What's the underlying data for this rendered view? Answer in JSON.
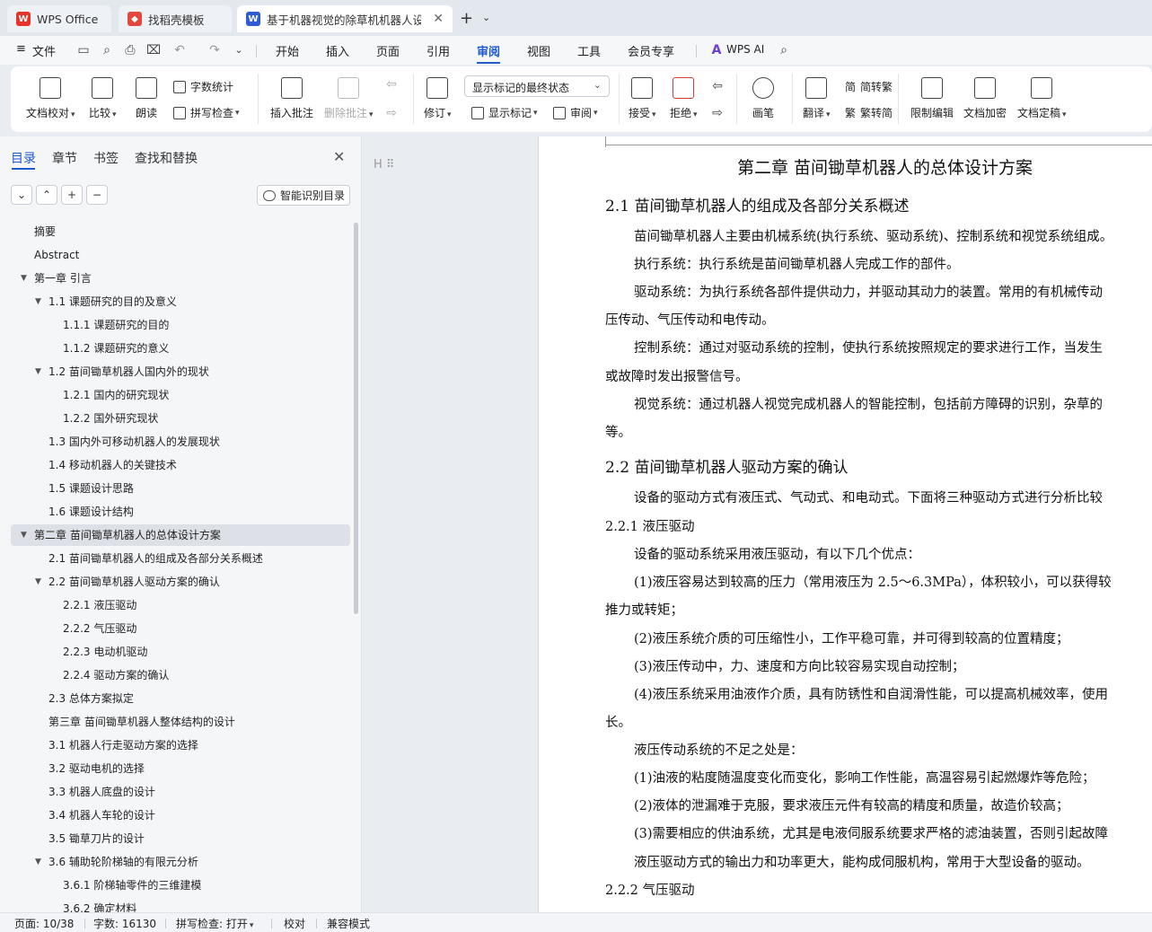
{
  "tabs": [
    {
      "label": "WPS Office",
      "active": false
    },
    {
      "label": "找稻壳模板",
      "active": false
    },
    {
      "label": "基于机器视觉的除草机机器人设",
      "active": true
    }
  ],
  "menubar": {
    "file": "文件",
    "items": [
      "开始",
      "插入",
      "页面",
      "引用",
      "审阅",
      "视图",
      "工具",
      "会员专享"
    ],
    "active": "审阅",
    "ai": "WPS AI"
  },
  "ribbon": {
    "doc_proof": "文档校对",
    "compare": "比较",
    "read_aloud": "朗读",
    "word_count": "字数统计",
    "spell_check": "拼写检查",
    "insert_comment": "插入批注",
    "delete_comment": "删除批注",
    "markup_state": "显示标记的最终状态",
    "track_changes": "修订",
    "show_markup": "显示标记",
    "review": "审阅",
    "accept": "接受",
    "reject": "拒绝",
    "pen": "画笔",
    "translate": "翻译",
    "to_traditional": "简转繁",
    "to_simplified": "繁转简",
    "restrict_edit": "限制编辑",
    "encrypt": "文档加密",
    "finalize": "文档定稿",
    "small_letter_trad": "繁",
    "small_letter_simp": "简"
  },
  "nav": {
    "tabs": [
      "目录",
      "章节",
      "书签",
      "查找和替换"
    ],
    "smart_toc": "智能识别目录",
    "items": [
      {
        "text": "摘要",
        "level": 1,
        "arrow": false
      },
      {
        "text": "Abstract",
        "level": 1,
        "arrow": false
      },
      {
        "text": "第一章  引言",
        "level": 1,
        "arrow": true
      },
      {
        "text": "1.1  课题研究的目的及意义",
        "level": 2,
        "arrow": true
      },
      {
        "text": "1.1.1 课题研究的目的",
        "level": 3,
        "arrow": false
      },
      {
        "text": "1.1.2  课题研究的意义",
        "level": 3,
        "arrow": false
      },
      {
        "text": "1.2 苗间锄草机器人国内外的现状",
        "level": 2,
        "arrow": true
      },
      {
        "text": "1.2.1 国内的研究现状",
        "level": 3,
        "arrow": false
      },
      {
        "text": "1.2.2 国外研究现状",
        "level": 3,
        "arrow": false
      },
      {
        "text": "1.3  国内外可移动机器人的发展现状",
        "level": 2,
        "arrow": false
      },
      {
        "text": "1.4  移动机器人的关键技术",
        "level": 2,
        "arrow": false
      },
      {
        "text": "1.5  课题设计思路",
        "level": 2,
        "arrow": false
      },
      {
        "text": "1.6  课题设计结构",
        "level": 2,
        "arrow": false
      },
      {
        "text": "第二章  苗间锄草机器人的总体设计方案",
        "level": 1,
        "arrow": true,
        "selected": true
      },
      {
        "text": "2.1 苗间锄草机器人的组成及各部分关系概述",
        "level": 2,
        "arrow": false
      },
      {
        "text": "2.2  苗间锄草机器人驱动方案的确认",
        "level": 2,
        "arrow": true
      },
      {
        "text": "2.2.1    液压驱动",
        "level": 3,
        "arrow": false
      },
      {
        "text": "2.2.2    气压驱动",
        "level": 3,
        "arrow": false
      },
      {
        "text": "2.2.3    电动机驱动",
        "level": 3,
        "arrow": false
      },
      {
        "text": "2.2.4    驱动方案的确认",
        "level": 3,
        "arrow": false
      },
      {
        "text": "2.3  总体方案拟定",
        "level": 2,
        "arrow": false
      },
      {
        "text": "第三章  苗间锄草机器人整体结构的设计",
        "level": 2,
        "arrow": false
      },
      {
        "text": "3.1 机器人行走驱动方案的选择",
        "level": 2,
        "arrow": false
      },
      {
        "text": "3.2 驱动电机的选择",
        "level": 2,
        "arrow": false
      },
      {
        "text": "3.3 机器人底盘的设计",
        "level": 2,
        "arrow": false
      },
      {
        "text": "3.4  机器人车轮的设计",
        "level": 2,
        "arrow": false
      },
      {
        "text": "3.5 锄草刀片的设计",
        "level": 2,
        "arrow": false
      },
      {
        "text": "3.6  辅助轮阶梯轴的有限元分析",
        "level": 2,
        "arrow": true
      },
      {
        "text": "3.6.1  阶梯轴零件的三维建模",
        "level": 3,
        "arrow": false
      },
      {
        "text": "3.6.2  确定材料",
        "level": 3,
        "arrow": false
      }
    ]
  },
  "document": {
    "heading_tool": "H",
    "lines": [
      {
        "text": "第二章  苗间锄草机器人的总体设计方案",
        "style": "chapter"
      },
      {
        "text": "2.1 苗间锄草机器人的组成及各部分关系概述",
        "style": "h2"
      },
      {
        "text": "苗间锄草机器人主要由机械系统(执行系统、驱动系统)、控制系统和视觉系统组成。",
        "style": "p"
      },
      {
        "text": "执行系统：执行系统是苗间锄草机器人完成工作的部件。",
        "style": "p"
      },
      {
        "text": "驱动系统：为执行系统各部件提供动力，并驱动其动力的装置。常用的有机械传动",
        "style": "p"
      },
      {
        "text": "压传动、气压传动和电传动。",
        "style": "p"
      },
      {
        "text": "控制系统：通过对驱动系统的控制，使执行系统按照规定的要求进行工作，当发生",
        "style": "p"
      },
      {
        "text": "或故障时发出报警信号。",
        "style": "p"
      },
      {
        "text": "视觉系统：通过机器人视觉完成机器人的智能控制，包括前方障碍的识别，杂草的",
        "style": "p"
      },
      {
        "text": "等。",
        "style": "p"
      },
      {
        "text": "2.2  苗间锄草机器人驱动方案的确认",
        "style": "h2"
      },
      {
        "text": "设备的驱动方式有液压式、气动式、和电动式。下面将三种驱动方式进行分析比较",
        "style": "p"
      },
      {
        "text": "2.2.1    液压驱动",
        "style": "h3"
      },
      {
        "text": "设备的驱动系统采用液压驱动，有以下几个优点：",
        "style": "p"
      },
      {
        "text": "(1)液压容易达到较高的压力（常用液压为 2.5～6.3MPa），体积较小，可以获得较",
        "style": "p"
      },
      {
        "text": "推力或转矩；",
        "style": "p"
      },
      {
        "text": "(2)液压系统介质的可压缩性小，工作平稳可靠，并可得到较高的位置精度；",
        "style": "p"
      },
      {
        "text": "(3)液压传动中，力、速度和方向比较容易实现自动控制；",
        "style": "p"
      },
      {
        "text": "(4)液压系统采用油液作介质，具有防锈性和自润滑性能，可以提高机械效率，使用",
        "style": "p"
      },
      {
        "text": "长。",
        "style": "p"
      },
      {
        "text": "液压传动系统的不足之处是：",
        "style": "p"
      },
      {
        "text": "(1)油液的粘度随温度变化而变化，影响工作性能，高温容易引起燃爆炸等危险；",
        "style": "p"
      },
      {
        "text": "(2)液体的泄漏难于克服，要求液压元件有较高的精度和质量，故造价较高；",
        "style": "p"
      },
      {
        "text": "(3)需要相应的供油系统，尤其是电液伺服系统要求严格的滤油装置，否则引起故障",
        "style": "p"
      },
      {
        "text": "液压驱动方式的输出力和功率更大，能构成伺服机构，常用于大型设备的驱动。",
        "style": "p"
      },
      {
        "text": "2.2.2    气压驱动",
        "style": "h3"
      }
    ]
  },
  "statusbar": {
    "page": "页面: 10/38",
    "words": "字数: 16130",
    "spell": "拼写检查: 打开",
    "proof": "校对",
    "compat": "兼容模式"
  },
  "colors": {
    "accent": "#1f5ad1",
    "wps_red": "#e8332a",
    "doc_blue": "#2f5bd3"
  }
}
